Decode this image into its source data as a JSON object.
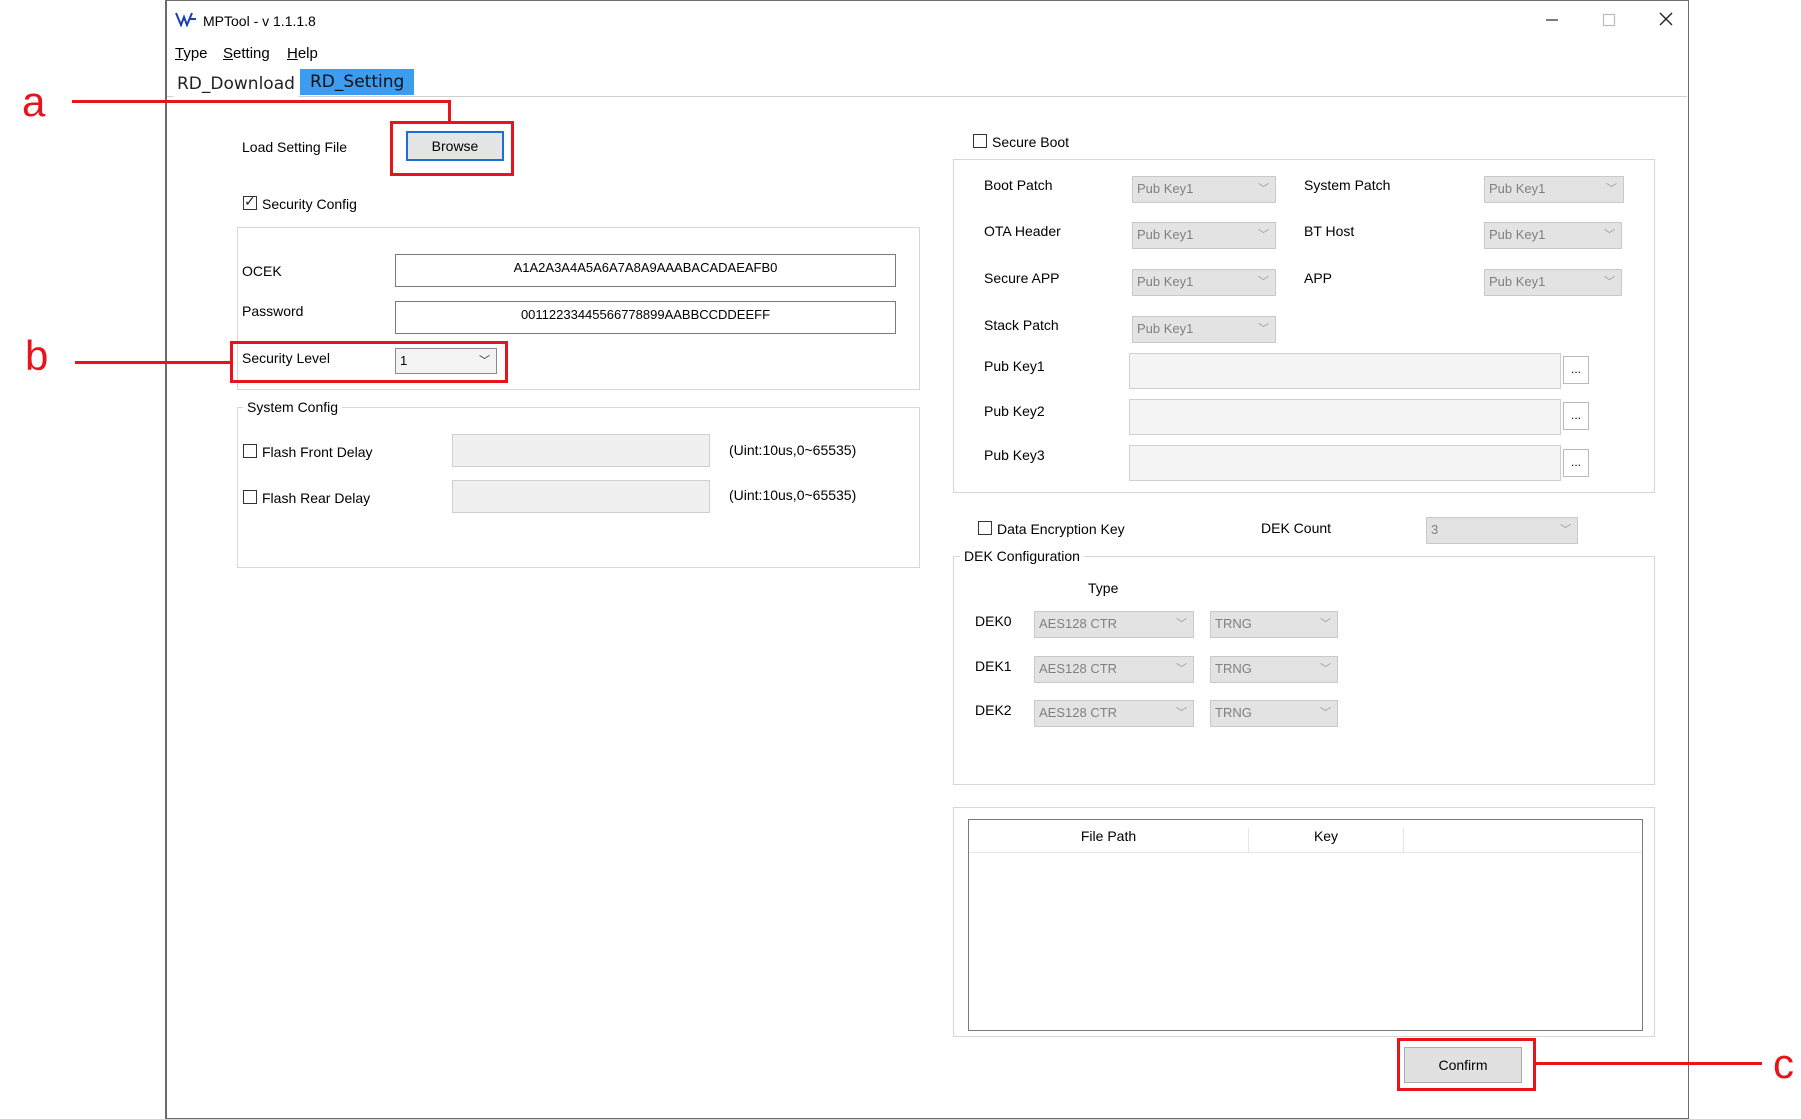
{
  "window": {
    "title": "MPTool - v 1.1.1.8",
    "icon": "mptool-logo-icon",
    "controls": [
      "–",
      "☐",
      "✕"
    ]
  },
  "menu": [
    {
      "label": "Type",
      "mnemonic": "T"
    },
    {
      "label": "Setting",
      "mnemonic": "S"
    },
    {
      "label": "Help",
      "mnemonic": "H"
    }
  ],
  "tabs": [
    {
      "label": "RD_Download",
      "selected": false
    },
    {
      "label": "RD_Setting",
      "selected": true
    }
  ],
  "left": {
    "load_setting_label": "Load Setting File",
    "browse_label": "Browse",
    "security_config": {
      "label": "Security Config",
      "checked": true
    },
    "ocek_label": "OCEK",
    "ocek_value": "A1A2A3A4A5A6A7A8A9AAABACADAEAFB0",
    "password_label": "Password",
    "password_value": "00112233445566778899AABBCCDDEEFF",
    "security_level_label": "Security Level",
    "security_level_value": "1",
    "system_config_label": "System Config",
    "flash_front_delay": {
      "label": "Flash Front Delay",
      "checked": false,
      "value": "",
      "hint": "(Uint:10us,0~65535)"
    },
    "flash_rear_delay": {
      "label": "Flash Rear Delay",
      "checked": false,
      "value": "",
      "hint": "(Uint:10us,0~65535)"
    }
  },
  "right": {
    "secure_boot": {
      "label": "Secure Boot",
      "checked": false
    },
    "boot_patch": {
      "label": "Boot Patch",
      "value": "Pub Key1"
    },
    "system_patch": {
      "label": "System Patch",
      "value": "Pub Key1"
    },
    "ota_header": {
      "label": "OTA Header",
      "value": "Pub Key1"
    },
    "bt_host": {
      "label": "BT Host",
      "value": "Pub Key1"
    },
    "secure_app": {
      "label": "Secure APP",
      "value": "Pub Key1"
    },
    "app": {
      "label": "APP",
      "value": "Pub Key1"
    },
    "stack_patch": {
      "label": "Stack Patch",
      "value": "Pub Key1"
    },
    "pub_keys": [
      {
        "label": "Pub Key1",
        "value": "",
        "button": "..."
      },
      {
        "label": "Pub Key2",
        "value": "",
        "button": "..."
      },
      {
        "label": "Pub Key3",
        "value": "",
        "button": "..."
      }
    ],
    "data_encryption_key": {
      "label": "Data Encryption Key",
      "checked": false
    },
    "dek_count_label": "DEK Count",
    "dek_count_value": "3",
    "dek_configuration_label": "DEK Configuration",
    "dek_type_header": "Type",
    "deks": [
      {
        "label": "DEK0",
        "algo": "AES128 CTR",
        "source": "TRNG"
      },
      {
        "label": "DEK1",
        "algo": "AES128 CTR",
        "source": "TRNG"
      },
      {
        "label": "DEK2",
        "algo": "AES128 CTR",
        "source": "TRNG"
      }
    ],
    "table_headers": [
      "File Path",
      "Key"
    ],
    "confirm_label": "Confirm"
  },
  "callouts": {
    "a": "a",
    "b": "b",
    "c": "c"
  },
  "colors": {
    "annotation_red": "#e8141c",
    "selected_tab": "#3c9cf0",
    "browse_border": "#1f6fd1"
  }
}
